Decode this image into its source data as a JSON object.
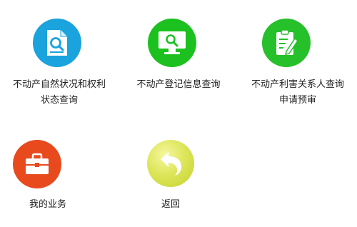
{
  "menu": {
    "items": [
      {
        "id": "property-status-query",
        "label_line1": "不动产自然状况和权利",
        "label_line2": "状态查询",
        "icon": "document-search-icon",
        "color": "#1aa3dc"
      },
      {
        "id": "registration-info-query",
        "label_line1": "不动产登记信息查询",
        "label_line2": "",
        "icon": "monitor-search-icon",
        "color": "#1cc11f"
      },
      {
        "id": "interested-party-query",
        "label_line1": "不动产利害关系人查询",
        "label_line2": "申请预审",
        "icon": "clipboard-edit-icon",
        "color": "#26c02a"
      },
      {
        "id": "my-business",
        "label_line1": "我的业务",
        "label_line2": "",
        "icon": "briefcase-icon",
        "color": "#e84a1e"
      },
      {
        "id": "back",
        "label_line1": "返回",
        "label_line2": "",
        "icon": "return-arrow-icon",
        "color": "#dde65a"
      }
    ]
  }
}
